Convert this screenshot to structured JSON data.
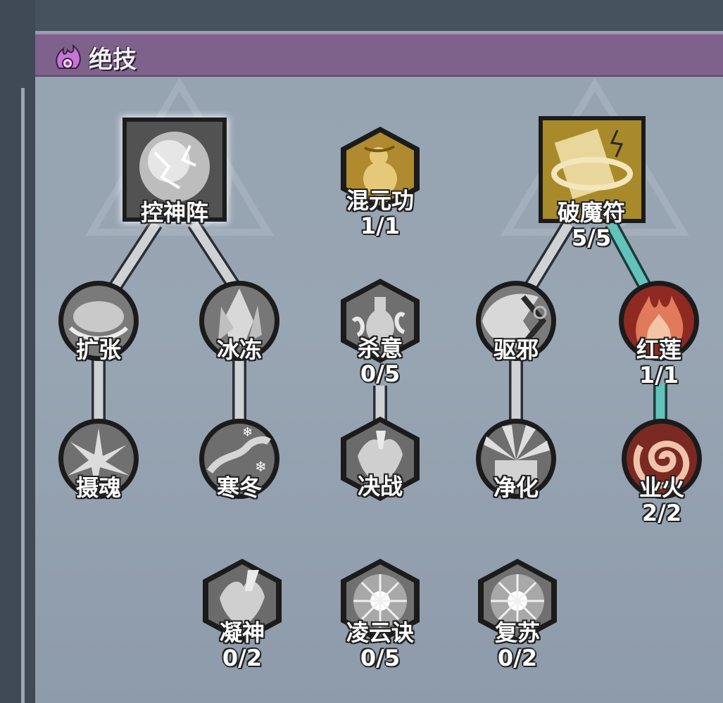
{
  "panel": {
    "title": "绝技",
    "title_icon": "purple-flame-icon"
  },
  "colors": {
    "header_bg": "#7e628c",
    "panel_bg": "#96a3b1",
    "link_grey": "#cfd2d4",
    "link_active": "#5fbfb8",
    "gold": "#c9a13a",
    "red": "#a8342a"
  },
  "skills": {
    "kongshenzhen": {
      "name": "控神阵",
      "count": "",
      "icon": "lightning-sphere-icon"
    },
    "hunyuangong": {
      "name": "混元功",
      "count": "1/1",
      "icon": "gold-gourd-icon"
    },
    "pomofu": {
      "name": "破魔符",
      "count": "5/5",
      "icon": "talisman-vortex-icon"
    },
    "kuozhang": {
      "name": "扩张",
      "count": "",
      "icon": "expand-sphere-icon"
    },
    "bingdong": {
      "name": "冰冻",
      "count": "",
      "icon": "ice-crystal-icon"
    },
    "shayi": {
      "name": "杀意",
      "count": "0/5",
      "icon": "bottle-smoke-icon"
    },
    "quxie": {
      "name": "驱邪",
      "count": "",
      "icon": "exorcise-icon"
    },
    "honglian": {
      "name": "红莲",
      "count": "1/1",
      "icon": "red-lotus-flame-icon"
    },
    "shehun": {
      "name": "摄魂",
      "count": "",
      "icon": "soul-burst-icon"
    },
    "handong": {
      "name": "寒冬",
      "count": "",
      "icon": "winter-snow-icon"
    },
    "juezhan": {
      "name": "决战",
      "count": "",
      "icon": "duel-fist-icon"
    },
    "jinghua": {
      "name": "净化",
      "count": "",
      "icon": "purify-rays-icon"
    },
    "yehuo": {
      "name": "业火",
      "count": "2/2",
      "icon": "red-spiral-icon"
    },
    "ningshen": {
      "name": "凝神",
      "count": "0/2",
      "icon": "focus-fist-icon"
    },
    "lingyunjue": {
      "name": "凌云诀",
      "count": "0/5",
      "icon": "cloud-spark-icon"
    },
    "fusu": {
      "name": "复苏",
      "count": "0/2",
      "icon": "revive-spark-icon"
    }
  }
}
